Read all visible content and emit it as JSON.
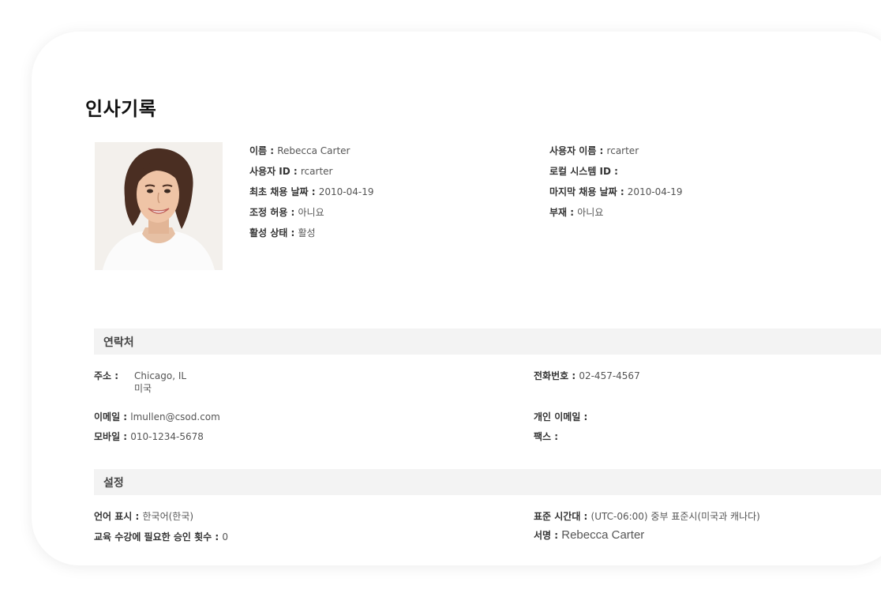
{
  "page": {
    "title": "인사기록"
  },
  "profile": {
    "left": [
      {
        "key": "이름 : ",
        "value": "Rebecca Carter"
      },
      {
        "key": "사용자 ID : ",
        "value": "rcarter"
      },
      {
        "key": "최초 채용 날짜 : ",
        "value": "2010-04-19"
      },
      {
        "key": "조정 허용 : ",
        "value": "아니요"
      },
      {
        "key": "활성 상태 : ",
        "value": "활성"
      }
    ],
    "right": [
      {
        "key": "사용자 이름 : ",
        "value": "rcarter"
      },
      {
        "key": "로컬 시스템 ID : ",
        "value": ""
      },
      {
        "key": "마지막 채용 날짜 : ",
        "value": "2010-04-19"
      },
      {
        "key": "부재 : ",
        "value": "아니요"
      }
    ]
  },
  "contact": {
    "heading": "연락처",
    "address_key": "주소 :",
    "address_line1": "Chicago, IL",
    "address_line2": "미국",
    "phone_key": "전화번호 : ",
    "phone": "02-457-4567",
    "email_key": "이메일 : ",
    "email": "lmullen@csod.com",
    "personal_email_key": "개인 이메일 : ",
    "personal_email": "",
    "mobile_key": "모바일 : ",
    "mobile": "010-1234-5678",
    "fax_key": "팩스 : ",
    "fax": ""
  },
  "settings": {
    "heading": "설정",
    "language_key": "언어 표시 : ",
    "language": "한국어(한국)",
    "timezone_key": "표준 시간대 : ",
    "timezone": "(UTC-06:00) 중부 표준시(미국과 캐나다)",
    "approvals_key": "교육 수강에 필요한 승인 횟수 : ",
    "approvals": "0",
    "signature_key": "서명 : ",
    "signature": "Rebecca Carter"
  }
}
